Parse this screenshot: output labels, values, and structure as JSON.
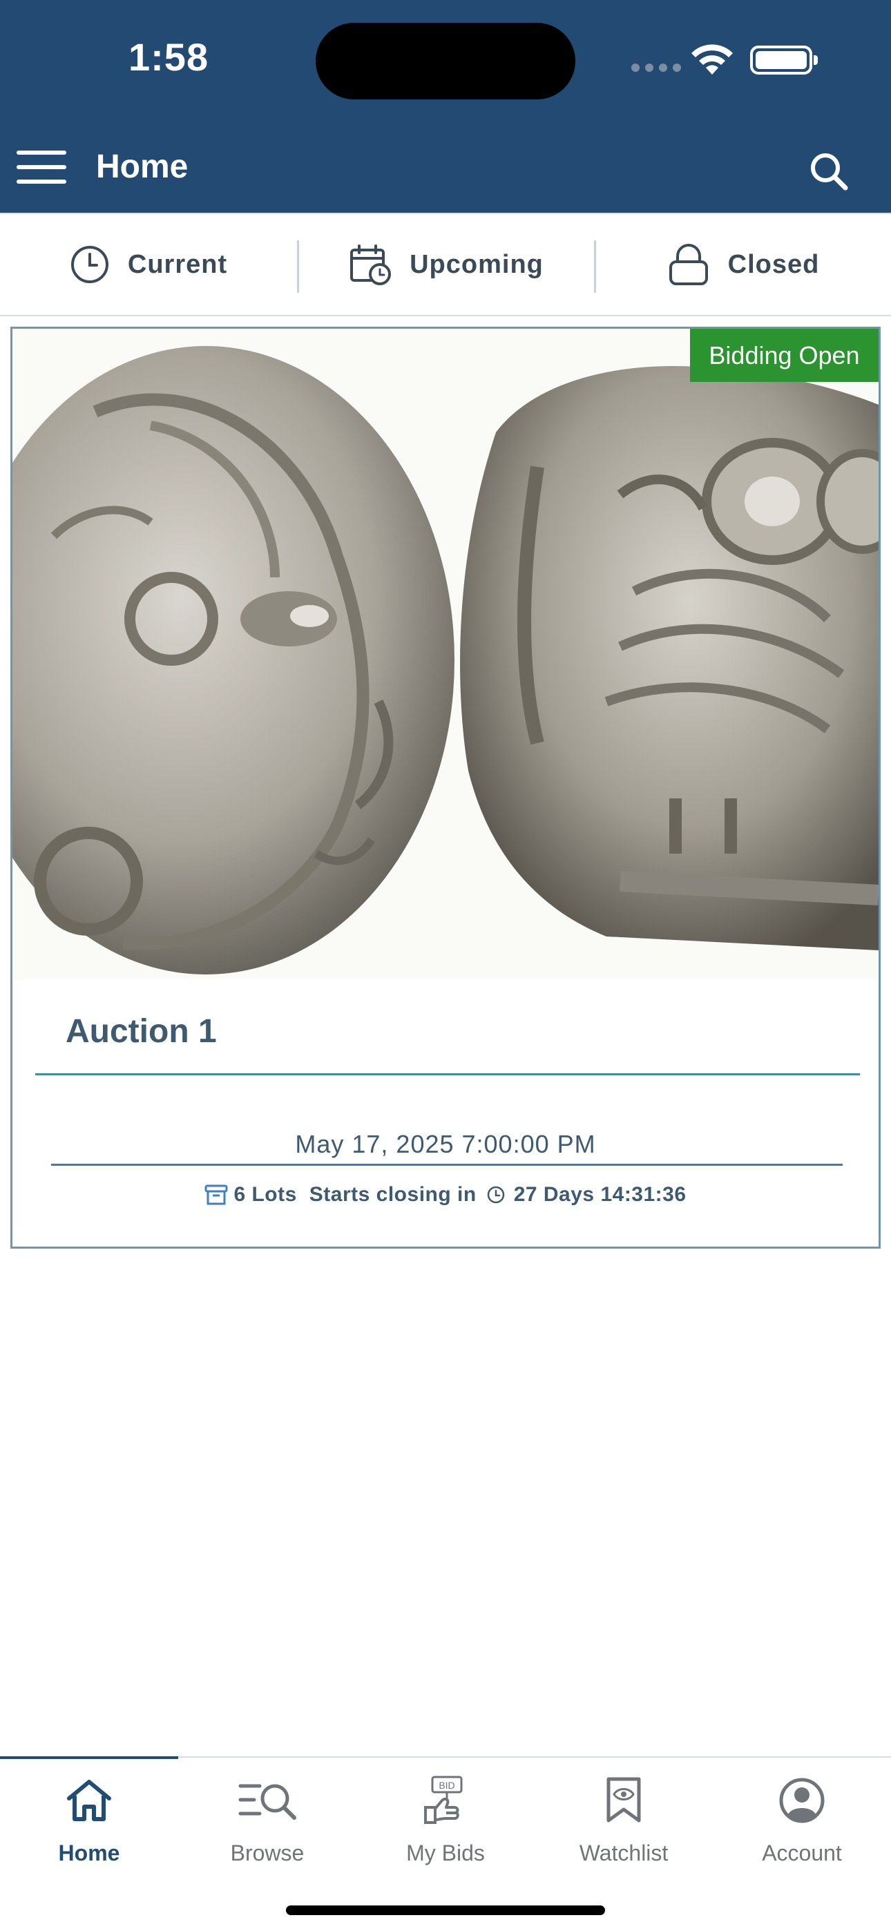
{
  "status_bar": {
    "time": "1:58"
  },
  "header": {
    "title": "Home",
    "menu_icon": "hamburger-menu-icon",
    "search_icon": "search-icon"
  },
  "tabs": [
    {
      "label": "Current",
      "icon": "clock-icon"
    },
    {
      "label": "Upcoming",
      "icon": "calendar-clock-icon"
    },
    {
      "label": "Closed",
      "icon": "lock-icon"
    }
  ],
  "auction": {
    "status_badge": "Bidding Open",
    "title": "Auction 1",
    "date": "May 17, 2025 7:00:00 PM",
    "lots": "6 Lots",
    "closing_label": "Starts closing in",
    "countdown": "27 Days 14:31:36",
    "image": "ancient-silver-coin-athena-owl"
  },
  "bottom_nav": [
    {
      "label": "Home",
      "icon": "home-icon",
      "active": true
    },
    {
      "label": "Browse",
      "icon": "browse-search-icon",
      "active": false
    },
    {
      "label": "My Bids",
      "icon": "bid-hand-icon",
      "active": false
    },
    {
      "label": "Watchlist",
      "icon": "bookmark-eye-icon",
      "active": false
    },
    {
      "label": "Account",
      "icon": "account-circle-icon",
      "active": false
    }
  ],
  "colors": {
    "header_bg": "#224a72",
    "badge_bg": "#2b9430",
    "accent": "#1f4d74",
    "card_border": "#6f96aa"
  }
}
